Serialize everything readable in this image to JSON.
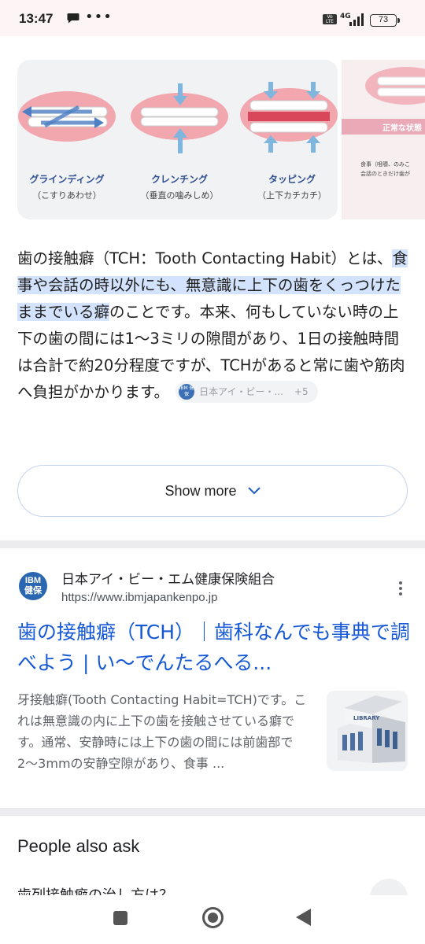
{
  "status_bar": {
    "time": "13:47",
    "more": "•••",
    "volte": "Vo LTE",
    "network": "4G",
    "battery": "73"
  },
  "image_carousel": {
    "items": [
      {
        "label": "グラインディング",
        "sub": "（こすりあわせ）"
      },
      {
        "label": "クレンチング",
        "sub": "（垂直の噛みしめ）"
      },
      {
        "label": "タッピング",
        "sub": "（上下カチカチ）"
      }
    ],
    "next_image": {
      "band_text": "正常な状態",
      "caption_line1": "食事（咀嚼、のみこ",
      "caption_line2": "会話のときだけ歯が"
    }
  },
  "ai_overview": {
    "text_before": "歯の接触癖（TCH：Tooth Contacting Habit）とは、",
    "text_highlight": "食事や会話の時以外にも、無意識に上下の歯をくっつけたままでいる癖",
    "text_after": "のことです。本来、何もしていない時の上下の歯の間には1〜3ミリの隙間があり、1日の接触時間は合計で約20分程度ですが、TCHがあると常に歯や筋肉へ負担がかかります。",
    "citation_source": "日本アイ・ビー・...",
    "citation_more": "+5",
    "citation_icon_text": "IBM 健保",
    "show_more_label": "Show more"
  },
  "result": {
    "favicon_text_1": "IBM",
    "favicon_text_2": "健保",
    "site_name": "日本アイ・ビー・エム健康保険組合",
    "url": "https://www.ibmjapankenpo.jp",
    "title": "歯の接触癖（TCH）｜歯科なんでも事典で調べよう | い〜でんたるへる...",
    "snippet": "牙接触癖(Tooth Contacting Habit=TCH)です。これは無意識の内に上下の歯を接触させている癖です。通常、安静時には上下の歯の間には前歯部で2〜3mmの安静空隙があり、食事 ...",
    "thumbnail_text": "LIBRARY"
  },
  "people_also_ask": {
    "title": "People also ask",
    "first_question_peek": "歯列接触癖の治し方は？"
  }
}
